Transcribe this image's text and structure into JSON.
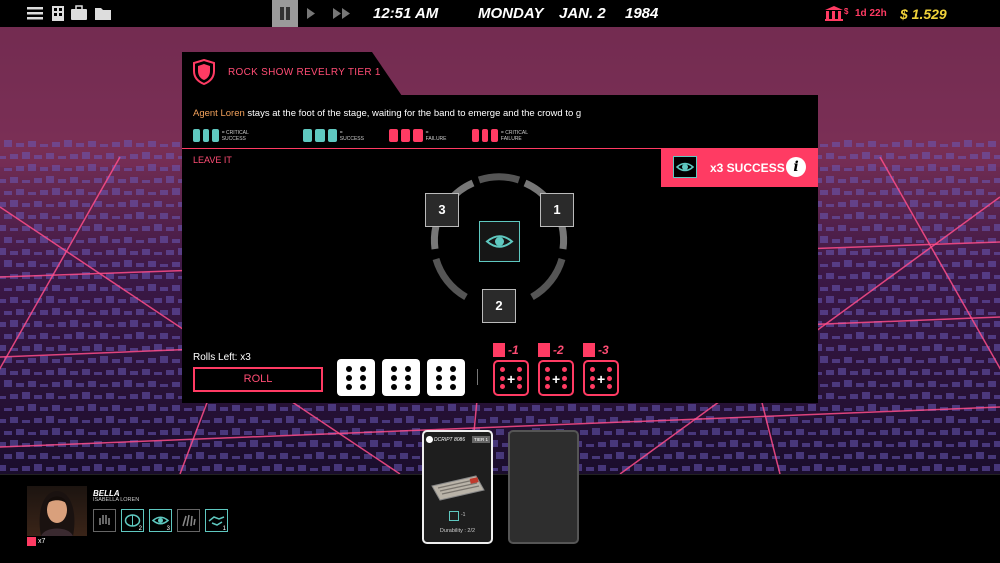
{
  "topbar": {
    "time": "12:51 AM",
    "weekday": "MONDAY",
    "date": "JAN. 2",
    "year": "1984",
    "timer": "1d 22h",
    "money": "$ 1.529",
    "icons": [
      "menu-icon",
      "building-icon",
      "briefcase-icon",
      "folder-icon",
      "pause-icon",
      "play-icon",
      "fast-forward-icon",
      "bank-icon"
    ]
  },
  "mission": {
    "title": "ROCK SHOW REVELRY TIER 1",
    "agent": "Agent Loren",
    "description": " stays at the foot of the stage, waiting for the band to emerge and the crowd to g",
    "legend": {
      "critical_success": "= CRITICAL SUCCESS",
      "success": "= SUCCESS",
      "failure": "= FAILURE",
      "critical_failure": "= CRITICAL FAILURE"
    },
    "leave_label": "LEAVE IT",
    "success_label": "x3 SUCCESS",
    "info_label": "i"
  },
  "wheel": {
    "slots": [
      "1",
      "2",
      "3"
    ]
  },
  "roll": {
    "rolls_left_label": "Rolls Left:",
    "rolls_left_value": "x3",
    "roll_button": "ROLL",
    "dice_values": [
      6,
      6,
      6
    ],
    "modifiers": [
      "-1",
      "-2",
      "-3"
    ]
  },
  "agent": {
    "name": "BELLA",
    "full_name": "ISABELLA LOREN",
    "energy": "x7",
    "skills": [
      {
        "icon": "hand-icon",
        "level": ""
      },
      {
        "icon": "brain-icon",
        "level": "2"
      },
      {
        "icon": "eye-icon",
        "level": "3"
      },
      {
        "icon": "glove-icon",
        "level": ""
      },
      {
        "icon": "handshake-icon",
        "level": "1"
      }
    ]
  },
  "card": {
    "name": "DCRIPT 8086",
    "tier": "TIER 1",
    "modifier": "-1",
    "durability": "Durability : 2/2"
  },
  "colors": {
    "accent": "#ff3b63",
    "teal": "#5fc8c0",
    "money": "#f0d23a",
    "agent_name": "#f0a05a"
  }
}
